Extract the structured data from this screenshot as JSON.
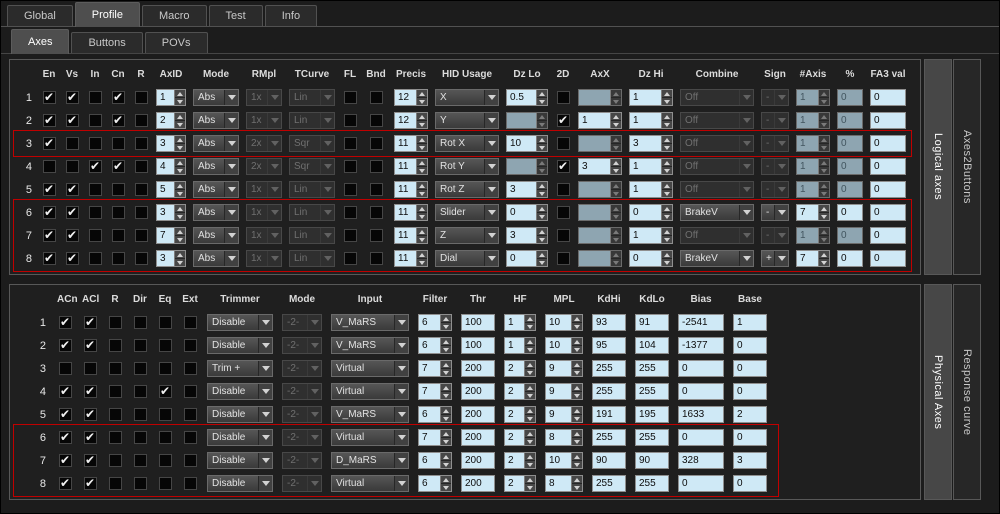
{
  "ui": {
    "check_glyph": "✔"
  },
  "colors": {
    "highlight": "#c00000",
    "field_enabled_bg": "#cfe9f6",
    "field_disabled_bg": "#8ea5b1",
    "active_tab_bg": "#4e4e4e"
  },
  "main_tabs": [
    {
      "label": "Global",
      "active": false
    },
    {
      "label": "Profile",
      "active": true
    },
    {
      "label": "Macro",
      "active": false
    },
    {
      "label": "Test",
      "active": false
    },
    {
      "label": "Info",
      "active": false
    }
  ],
  "sub_tabs": [
    {
      "label": "Axes",
      "active": true
    },
    {
      "label": "Buttons",
      "active": false
    },
    {
      "label": "POVs",
      "active": false
    }
  ],
  "logical_axes": {
    "side_tabs": [
      {
        "label": "Logical axes",
        "active": true
      },
      {
        "label": "Axes2Buttons",
        "active": false
      }
    ],
    "columns": [
      "",
      "En",
      "Vs",
      "In",
      "Cn",
      "R",
      "AxID",
      "Mode",
      "RMpl",
      "TCurve",
      "FL",
      "Bnd",
      "Precis",
      "HID Usage",
      "Dz Lo",
      "2D",
      "AxX",
      "Dz Hi",
      "Combine",
      "Sign",
      "#Axis",
      "%",
      "FA3 val"
    ],
    "highlights": [
      {
        "from": 3,
        "to": 3
      },
      {
        "from": 6,
        "to": 8
      }
    ],
    "rows": [
      {
        "n": "1",
        "en": 1,
        "vs": 1,
        "in": 0,
        "cn": 1,
        "r": 0,
        "axid": {
          "v": "1",
          "d": 0
        },
        "mode": {
          "v": "Abs",
          "d": 0
        },
        "rmpl": {
          "v": "1x",
          "d": 1
        },
        "tcurve": {
          "v": "Lin",
          "d": 1
        },
        "fl": 0,
        "bnd": 0,
        "precis": {
          "v": "12",
          "d": 0
        },
        "hid": {
          "v": "X",
          "d": 0
        },
        "dzlo": {
          "v": "0.5",
          "d": 0
        },
        "d2": 0,
        "axx": {
          "v": "",
          "d": 1
        },
        "dzhi": {
          "v": "1",
          "d": 0
        },
        "combine": {
          "v": "Off",
          "d": 1
        },
        "sign": {
          "v": "-",
          "d": 1
        },
        "naxis": {
          "v": "1",
          "d": 1
        },
        "pct": {
          "v": "0",
          "d": 1
        },
        "fa3": {
          "v": "0",
          "d": 0
        }
      },
      {
        "n": "2",
        "en": 1,
        "vs": 1,
        "in": 0,
        "cn": 1,
        "r": 0,
        "axid": {
          "v": "2",
          "d": 0
        },
        "mode": {
          "v": "Abs",
          "d": 0
        },
        "rmpl": {
          "v": "1x",
          "d": 1
        },
        "tcurve": {
          "v": "Lin",
          "d": 1
        },
        "fl": 0,
        "bnd": 0,
        "precis": {
          "v": "12",
          "d": 0
        },
        "hid": {
          "v": "Y",
          "d": 0
        },
        "dzlo": {
          "v": "",
          "d": 1
        },
        "d2": 1,
        "axx": {
          "v": "1",
          "d": 0
        },
        "dzhi": {
          "v": "1",
          "d": 0
        },
        "combine": {
          "v": "Off",
          "d": 1
        },
        "sign": {
          "v": "-",
          "d": 1
        },
        "naxis": {
          "v": "1",
          "d": 1
        },
        "pct": {
          "v": "0",
          "d": 1
        },
        "fa3": {
          "v": "0",
          "d": 0
        }
      },
      {
        "n": "3",
        "en": 1,
        "vs": 0,
        "in": 0,
        "cn": 0,
        "r": 0,
        "axid": {
          "v": "3",
          "d": 0
        },
        "mode": {
          "v": "Abs",
          "d": 0
        },
        "rmpl": {
          "v": "2x",
          "d": 1
        },
        "tcurve": {
          "v": "Sqr",
          "d": 1
        },
        "fl": 0,
        "bnd": 0,
        "precis": {
          "v": "11",
          "d": 0
        },
        "hid": {
          "v": "Rot X",
          "d": 0
        },
        "dzlo": {
          "v": "10",
          "d": 0
        },
        "d2": 0,
        "axx": {
          "v": "",
          "d": 1
        },
        "dzhi": {
          "v": "3",
          "d": 0
        },
        "combine": {
          "v": "Off",
          "d": 1
        },
        "sign": {
          "v": "-",
          "d": 1
        },
        "naxis": {
          "v": "1",
          "d": 1
        },
        "pct": {
          "v": "0",
          "d": 1
        },
        "fa3": {
          "v": "0",
          "d": 0
        }
      },
      {
        "n": "4",
        "en": 0,
        "vs": 0,
        "in": 1,
        "cn": 1,
        "r": 0,
        "axid": {
          "v": "4",
          "d": 0
        },
        "mode": {
          "v": "Abs",
          "d": 0
        },
        "rmpl": {
          "v": "2x",
          "d": 1
        },
        "tcurve": {
          "v": "Sqr",
          "d": 1
        },
        "fl": 0,
        "bnd": 0,
        "precis": {
          "v": "11",
          "d": 0
        },
        "hid": {
          "v": "Rot Y",
          "d": 0
        },
        "dzlo": {
          "v": "",
          "d": 1
        },
        "d2": 1,
        "axx": {
          "v": "3",
          "d": 0
        },
        "dzhi": {
          "v": "1",
          "d": 0
        },
        "combine": {
          "v": "Off",
          "d": 1
        },
        "sign": {
          "v": "-",
          "d": 1
        },
        "naxis": {
          "v": "1",
          "d": 1
        },
        "pct": {
          "v": "0",
          "d": 1
        },
        "fa3": {
          "v": "0",
          "d": 0
        }
      },
      {
        "n": "5",
        "en": 1,
        "vs": 1,
        "in": 0,
        "cn": 0,
        "r": 0,
        "axid": {
          "v": "5",
          "d": 0
        },
        "mode": {
          "v": "Abs",
          "d": 0
        },
        "rmpl": {
          "v": "1x",
          "d": 1
        },
        "tcurve": {
          "v": "Lin",
          "d": 1
        },
        "fl": 0,
        "bnd": 0,
        "precis": {
          "v": "11",
          "d": 0
        },
        "hid": {
          "v": "Rot Z",
          "d": 0
        },
        "dzlo": {
          "v": "3",
          "d": 0
        },
        "d2": 0,
        "axx": {
          "v": "",
          "d": 1
        },
        "dzhi": {
          "v": "1",
          "d": 0
        },
        "combine": {
          "v": "Off",
          "d": 1
        },
        "sign": {
          "v": "-",
          "d": 1
        },
        "naxis": {
          "v": "1",
          "d": 1
        },
        "pct": {
          "v": "0",
          "d": 1
        },
        "fa3": {
          "v": "0",
          "d": 0
        }
      },
      {
        "n": "6",
        "en": 1,
        "vs": 1,
        "in": 0,
        "cn": 0,
        "r": 0,
        "axid": {
          "v": "3",
          "d": 0
        },
        "mode": {
          "v": "Abs",
          "d": 0
        },
        "rmpl": {
          "v": "1x",
          "d": 1
        },
        "tcurve": {
          "v": "Lin",
          "d": 1
        },
        "fl": 0,
        "bnd": 0,
        "precis": {
          "v": "11",
          "d": 0
        },
        "hid": {
          "v": "Slider",
          "d": 0
        },
        "dzlo": {
          "v": "0",
          "d": 0
        },
        "d2": 0,
        "axx": {
          "v": "",
          "d": 1
        },
        "dzhi": {
          "v": "0",
          "d": 0
        },
        "combine": {
          "v": "BrakeV",
          "d": 0
        },
        "sign": {
          "v": "-",
          "d": 0
        },
        "naxis": {
          "v": "7",
          "d": 0
        },
        "pct": {
          "v": "0",
          "d": 0
        },
        "fa3": {
          "v": "0",
          "d": 0
        }
      },
      {
        "n": "7",
        "en": 1,
        "vs": 1,
        "in": 0,
        "cn": 0,
        "r": 0,
        "axid": {
          "v": "7",
          "d": 0
        },
        "mode": {
          "v": "Abs",
          "d": 0
        },
        "rmpl": {
          "v": "1x",
          "d": 1
        },
        "tcurve": {
          "v": "Lin",
          "d": 1
        },
        "fl": 0,
        "bnd": 0,
        "precis": {
          "v": "11",
          "d": 0
        },
        "hid": {
          "v": "Z",
          "d": 0
        },
        "dzlo": {
          "v": "3",
          "d": 0
        },
        "d2": 0,
        "axx": {
          "v": "",
          "d": 1
        },
        "dzhi": {
          "v": "1",
          "d": 0
        },
        "combine": {
          "v": "Off",
          "d": 1
        },
        "sign": {
          "v": "-",
          "d": 1
        },
        "naxis": {
          "v": "1",
          "d": 1
        },
        "pct": {
          "v": "0",
          "d": 1
        },
        "fa3": {
          "v": "0",
          "d": 0
        }
      },
      {
        "n": "8",
        "en": 1,
        "vs": 1,
        "in": 0,
        "cn": 0,
        "r": 0,
        "axid": {
          "v": "3",
          "d": 0
        },
        "mode": {
          "v": "Abs",
          "d": 0
        },
        "rmpl": {
          "v": "1x",
          "d": 1
        },
        "tcurve": {
          "v": "Lin",
          "d": 1
        },
        "fl": 0,
        "bnd": 0,
        "precis": {
          "v": "11",
          "d": 0
        },
        "hid": {
          "v": "Dial",
          "d": 0
        },
        "dzlo": {
          "v": "0",
          "d": 0
        },
        "d2": 0,
        "axx": {
          "v": "",
          "d": 1
        },
        "dzhi": {
          "v": "0",
          "d": 0
        },
        "combine": {
          "v": "BrakeV",
          "d": 0
        },
        "sign": {
          "v": "+",
          "d": 0
        },
        "naxis": {
          "v": "7",
          "d": 0
        },
        "pct": {
          "v": "0",
          "d": 0
        },
        "fa3": {
          "v": "0",
          "d": 0
        }
      }
    ]
  },
  "physical_axes": {
    "side_tabs": [
      {
        "label": "Physical Axes",
        "active": true
      },
      {
        "label": "Response curve",
        "active": false
      }
    ],
    "columns": [
      "",
      "ACn",
      "ACl",
      "R",
      "Dir",
      "Eq",
      "Ext",
      "Trimmer",
      "Mode",
      "Input",
      "Filter",
      "Thr",
      "HF",
      "MPL",
      "KdHi",
      "KdLo",
      "Bias",
      "Base"
    ],
    "highlights": [
      {
        "from": 6,
        "to": 8
      }
    ],
    "rows": [
      {
        "n": "1",
        "acn": 1,
        "acl": 1,
        "r": 0,
        "dir": 0,
        "eq": 0,
        "ext": 0,
        "trimmer": {
          "v": "Disable",
          "d": 0
        },
        "mode": {
          "v": "-2-",
          "d": 1
        },
        "input": {
          "v": "V_MaRS",
          "d": 0
        },
        "filter": {
          "v": "6",
          "d": 0
        },
        "thr": {
          "v": "100",
          "d": 0
        },
        "hf": {
          "v": "1",
          "d": 0
        },
        "mpl": {
          "v": "10",
          "d": 0
        },
        "kdhi": {
          "v": "93",
          "d": 0
        },
        "kdlo": {
          "v": "91",
          "d": 0
        },
        "bias": {
          "v": "-2541",
          "d": 0
        },
        "base": {
          "v": "1",
          "d": 0
        }
      },
      {
        "n": "2",
        "acn": 1,
        "acl": 1,
        "r": 0,
        "dir": 0,
        "eq": 0,
        "ext": 0,
        "trimmer": {
          "v": "Disable",
          "d": 0
        },
        "mode": {
          "v": "-2-",
          "d": 1
        },
        "input": {
          "v": "V_MaRS",
          "d": 0
        },
        "filter": {
          "v": "6",
          "d": 0
        },
        "thr": {
          "v": "100",
          "d": 0
        },
        "hf": {
          "v": "1",
          "d": 0
        },
        "mpl": {
          "v": "10",
          "d": 0
        },
        "kdhi": {
          "v": "95",
          "d": 0
        },
        "kdlo": {
          "v": "104",
          "d": 0
        },
        "bias": {
          "v": "-1377",
          "d": 0
        },
        "base": {
          "v": "0",
          "d": 0
        }
      },
      {
        "n": "3",
        "acn": 0,
        "acl": 0,
        "r": 0,
        "dir": 0,
        "eq": 0,
        "ext": 0,
        "trimmer": {
          "v": "Trim +",
          "d": 0
        },
        "mode": {
          "v": "-2-",
          "d": 1
        },
        "input": {
          "v": "Virtual",
          "d": 0
        },
        "filter": {
          "v": "7",
          "d": 0
        },
        "thr": {
          "v": "200",
          "d": 0
        },
        "hf": {
          "v": "2",
          "d": 0
        },
        "mpl": {
          "v": "9",
          "d": 0
        },
        "kdhi": {
          "v": "255",
          "d": 0
        },
        "kdlo": {
          "v": "255",
          "d": 0
        },
        "bias": {
          "v": "0",
          "d": 0
        },
        "base": {
          "v": "0",
          "d": 0
        }
      },
      {
        "n": "4",
        "acn": 1,
        "acl": 1,
        "r": 0,
        "dir": 0,
        "eq": 1,
        "ext": 0,
        "trimmer": {
          "v": "Disable",
          "d": 0
        },
        "mode": {
          "v": "-2-",
          "d": 1
        },
        "input": {
          "v": "Virtual",
          "d": 0
        },
        "filter": {
          "v": "7",
          "d": 0
        },
        "thr": {
          "v": "200",
          "d": 0
        },
        "hf": {
          "v": "2",
          "d": 0
        },
        "mpl": {
          "v": "9",
          "d": 0
        },
        "kdhi": {
          "v": "255",
          "d": 0
        },
        "kdlo": {
          "v": "255",
          "d": 0
        },
        "bias": {
          "v": "0",
          "d": 0
        },
        "base": {
          "v": "0",
          "d": 0
        }
      },
      {
        "n": "5",
        "acn": 1,
        "acl": 1,
        "r": 0,
        "dir": 0,
        "eq": 0,
        "ext": 0,
        "trimmer": {
          "v": "Disable",
          "d": 0
        },
        "mode": {
          "v": "-2-",
          "d": 1
        },
        "input": {
          "v": "V_MaRS",
          "d": 0
        },
        "filter": {
          "v": "6",
          "d": 0
        },
        "thr": {
          "v": "200",
          "d": 0
        },
        "hf": {
          "v": "2",
          "d": 0
        },
        "mpl": {
          "v": "9",
          "d": 0
        },
        "kdhi": {
          "v": "191",
          "d": 0
        },
        "kdlo": {
          "v": "195",
          "d": 0
        },
        "bias": {
          "v": "1633",
          "d": 0
        },
        "base": {
          "v": "2",
          "d": 0
        }
      },
      {
        "n": "6",
        "acn": 1,
        "acl": 1,
        "r": 0,
        "dir": 0,
        "eq": 0,
        "ext": 0,
        "trimmer": {
          "v": "Disable",
          "d": 0
        },
        "mode": {
          "v": "-2-",
          "d": 1
        },
        "input": {
          "v": "Virtual",
          "d": 0
        },
        "filter": {
          "v": "7",
          "d": 0
        },
        "thr": {
          "v": "200",
          "d": 0
        },
        "hf": {
          "v": "2",
          "d": 0
        },
        "mpl": {
          "v": "8",
          "d": 0
        },
        "kdhi": {
          "v": "255",
          "d": 0
        },
        "kdlo": {
          "v": "255",
          "d": 0
        },
        "bias": {
          "v": "0",
          "d": 0
        },
        "base": {
          "v": "0",
          "d": 0
        }
      },
      {
        "n": "7",
        "acn": 1,
        "acl": 1,
        "r": 0,
        "dir": 0,
        "eq": 0,
        "ext": 0,
        "trimmer": {
          "v": "Disable",
          "d": 0
        },
        "mode": {
          "v": "-2-",
          "d": 1
        },
        "input": {
          "v": "D_MaRS",
          "d": 0
        },
        "filter": {
          "v": "6",
          "d": 0
        },
        "thr": {
          "v": "200",
          "d": 0
        },
        "hf": {
          "v": "2",
          "d": 0
        },
        "mpl": {
          "v": "10",
          "d": 0
        },
        "kdhi": {
          "v": "90",
          "d": 0
        },
        "kdlo": {
          "v": "90",
          "d": 0
        },
        "bias": {
          "v": "328",
          "d": 0
        },
        "base": {
          "v": "3",
          "d": 0
        }
      },
      {
        "n": "8",
        "acn": 1,
        "acl": 1,
        "r": 0,
        "dir": 0,
        "eq": 0,
        "ext": 0,
        "trimmer": {
          "v": "Disable",
          "d": 0
        },
        "mode": {
          "v": "-2-",
          "d": 1
        },
        "input": {
          "v": "Virtual",
          "d": 0
        },
        "filter": {
          "v": "6",
          "d": 0
        },
        "thr": {
          "v": "200",
          "d": 0
        },
        "hf": {
          "v": "2",
          "d": 0
        },
        "mpl": {
          "v": "8",
          "d": 0
        },
        "kdhi": {
          "v": "255",
          "d": 0
        },
        "kdlo": {
          "v": "255",
          "d": 0
        },
        "bias": {
          "v": "0",
          "d": 0
        },
        "base": {
          "v": "0",
          "d": 0
        }
      }
    ]
  }
}
